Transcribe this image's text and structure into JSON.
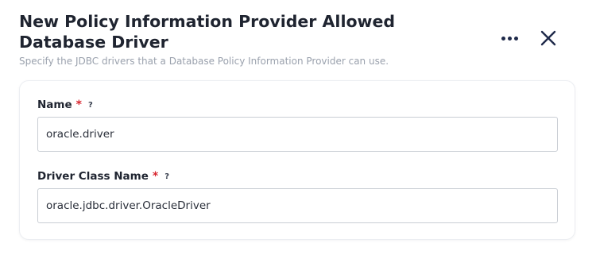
{
  "dialog": {
    "title": "New Policy Information Provider Allowed Database Driver",
    "subtitle": "Specify the JDBC drivers that a Database Policy Information Provider can use.",
    "more_icon": "more-horizontal-icon",
    "close_icon": "close-icon"
  },
  "form": {
    "name": {
      "label": "Name",
      "required_marker": "*",
      "help_marker": "?",
      "value": "oracle.driver"
    },
    "driver_class_name": {
      "label": "Driver Class Name",
      "required_marker": "*",
      "help_marker": "?",
      "value": "oracle.jdbc.driver.OracleDriver"
    }
  },
  "colors": {
    "title": "#1f2430",
    "subtitle": "#9aa1ad",
    "required": "#d8262f",
    "icon": "#1f2a4a",
    "input_border": "#c9cdd4"
  }
}
